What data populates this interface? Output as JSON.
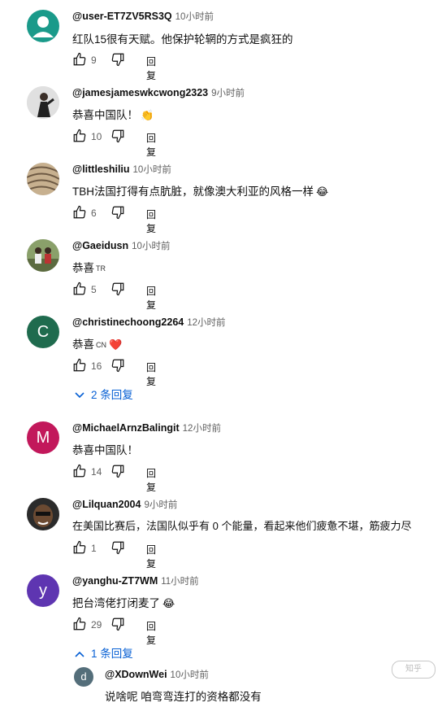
{
  "reply_label": "回复",
  "comments": [
    {
      "avatar_letter": "",
      "avatar_color": "#1a9a8a",
      "handle": "@user-ET7ZV5RS3Q",
      "time": "10小时前",
      "text": "红队15很有天赋。他保护轮辋的方式是疯狂的",
      "likes": "9"
    },
    {
      "avatar_letter": "",
      "avatar_color": "#d9d9d9",
      "handle": "@jamesjameswkcwong2323",
      "time": "9小时前",
      "text": "恭喜中国队！",
      "emoji": "👏",
      "likes": "10"
    },
    {
      "avatar_letter": "",
      "avatar_color": "#a88f70",
      "handle": "@littleshiliu",
      "time": "10小时前",
      "text": "TBH法国打得有点肮脏，就像澳大利亚的风格一样",
      "emoji": "😂",
      "likes": "6"
    },
    {
      "avatar_letter": "",
      "avatar_color": "#7d8a68",
      "handle": "@Gaeidusn",
      "time": "10小时前",
      "text": "恭喜",
      "tag": "TR",
      "likes": "5"
    },
    {
      "avatar_letter": "C",
      "avatar_color": "#1f6b4e",
      "handle": "@christinechoong2264",
      "time": "12小时前",
      "text": "恭喜",
      "tag": "CN",
      "emoji": "❤️",
      "likes": "16",
      "replies_label": "2 条回复"
    },
    {
      "avatar_letter": "M",
      "avatar_color": "#c2185b",
      "handle": "@MichaelArnzBalingit",
      "time": "12小时前",
      "text": "恭喜中国队！",
      "likes": "14"
    },
    {
      "avatar_letter": "",
      "avatar_color": "#5a4636",
      "handle": "@Lilquan2004",
      "time": "9小时前",
      "text": "在美国比赛后，法国队似乎有 0 个能量，看起来他们疲惫不堪，筋疲力尽",
      "likes": "1"
    },
    {
      "avatar_letter": "y",
      "avatar_color": "#5e35b1",
      "handle": "@yanghu-ZT7WM",
      "time": "11小时前",
      "text": "把台湾佬打闭麦了",
      "emoji": "😂",
      "likes": "29",
      "replies_label": "1 条回复"
    }
  ],
  "reply": {
    "avatar_letter": "d",
    "avatar_color": "#546e7a",
    "handle": "@XDownWei",
    "time": "10小时前",
    "text": "说啥呢 咱弯弯连打的资格都没有"
  },
  "watermark_text": "知乎"
}
